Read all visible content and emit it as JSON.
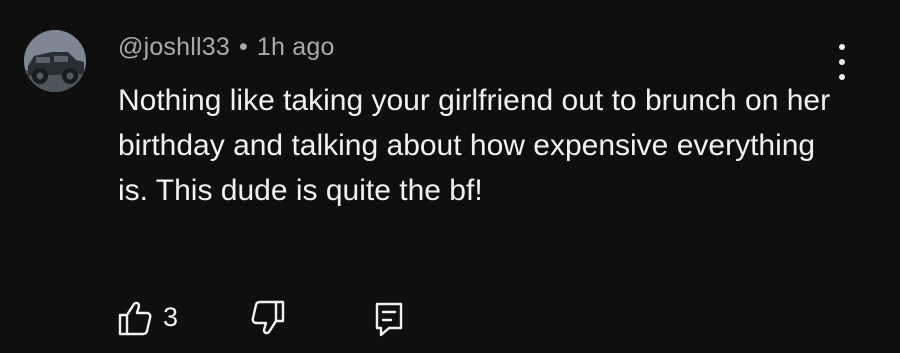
{
  "comment": {
    "username": "@joshll33",
    "separator": "•",
    "timestamp": "1h ago",
    "text": "Nothing like taking your girlfriend out to brunch on her birthday and talking about how expensive everything is. This dude is quite the bf!",
    "like_count": "3"
  },
  "icons": {
    "avatar": "avatar-truck",
    "menu": "more-vertical-icon",
    "like": "thumbs-up-icon",
    "dislike": "thumbs-down-icon",
    "reply": "reply-comment-icon"
  },
  "colors": {
    "background": "#0f0f0f",
    "primary_text": "#f1f1f1",
    "secondary_text": "#aaaaaa"
  }
}
